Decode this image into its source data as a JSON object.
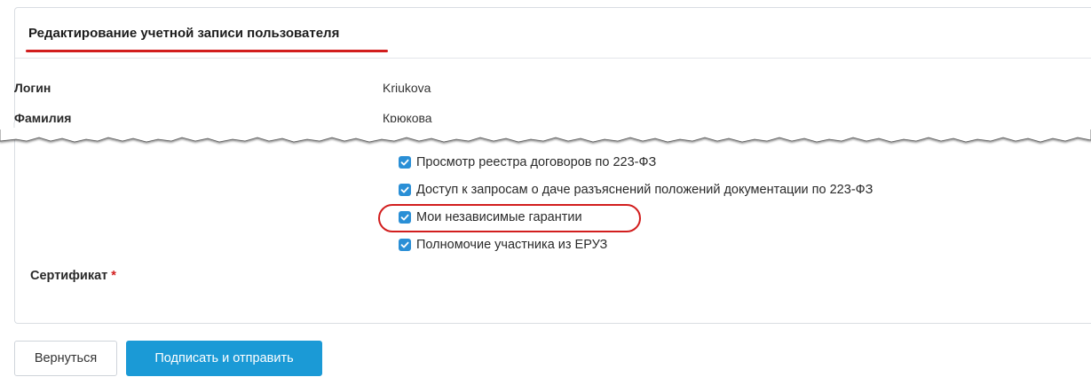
{
  "card": {
    "title": "Редактирование учетной записи пользователя"
  },
  "fields": [
    {
      "label": "Логин",
      "value": "Kriukova"
    },
    {
      "label": "Фамилия",
      "value": "Крюкова"
    }
  ],
  "permissions": [
    {
      "label": "Просмотр реестра договоров по 223-ФЗ",
      "checked": true
    },
    {
      "label": "Доступ к запросам о даче разъяснений положений документации по 223-ФЗ",
      "checked": true
    },
    {
      "label": "Мои независимые гарантии",
      "checked": true,
      "highlighted": true
    },
    {
      "label": "Полномочие участника из ЕРУЗ",
      "checked": true
    }
  ],
  "certificate": {
    "label": "Сертификат",
    "required_mark": "*"
  },
  "buttons": {
    "back": "Вернуться",
    "sign_submit": "Подписать и отправить"
  },
  "colors": {
    "accent": "#1b9ad6",
    "checkbox": "#2a8fd6",
    "annotation_red": "#d21e1e"
  }
}
